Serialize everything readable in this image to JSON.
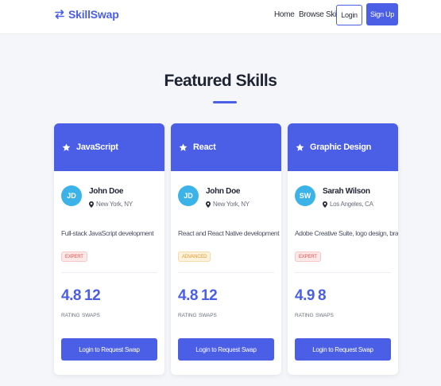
{
  "nav": {
    "brand": "SkillSwap",
    "links": [
      "Home",
      "Browse Skills"
    ],
    "login": "Login",
    "signup": "Sign Up"
  },
  "section": {
    "title": "Featured Skills"
  },
  "cards": [
    {
      "skill": "JavaScript",
      "initials": "JD",
      "name": "John Doe",
      "location": "New York, NY",
      "description": "Full-stack JavaScript development",
      "level": "EXPERT",
      "rating": "4.8",
      "swaps": "12",
      "rating_label": "RATING",
      "swaps_label": "SWAPS",
      "button": "Login to Request Swap"
    },
    {
      "skill": "React",
      "initials": "JD",
      "name": "John Doe",
      "location": "New York, NY",
      "description": "React and React Native development",
      "level": "ADVANCED",
      "rating": "4.8",
      "swaps": "12",
      "rating_label": "RATING",
      "swaps_label": "SWAPS",
      "button": "Login to Request Swap"
    },
    {
      "skill": "Graphic Design",
      "initials": "SW",
      "name": "Sarah Wilson",
      "location": "Los Angeles, CA",
      "description": "Adobe Creative Suite, logo design, branding",
      "level": "EXPERT",
      "rating": "4.9",
      "swaps": "8",
      "rating_label": "RATING",
      "swaps_label": "SWAPS",
      "button": "Login to Request Swap"
    }
  ],
  "colors": {
    "accent": "#4a5ee6",
    "avatar": "#3bb2e8",
    "expert": "#d9534f",
    "advanced": "#e29b26"
  }
}
